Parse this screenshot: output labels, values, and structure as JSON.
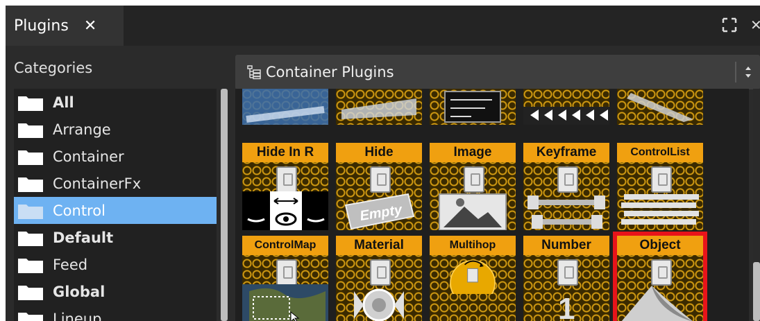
{
  "window": {
    "tab_label": "Plugins",
    "tab_close": "✕",
    "close_glyph": "✕"
  },
  "sidebar": {
    "header": "Categories",
    "items": [
      {
        "label": "All",
        "bold": true
      },
      {
        "label": "Arrange",
        "bold": false
      },
      {
        "label": "Container",
        "bold": false
      },
      {
        "label": "ContainerFx",
        "bold": false
      },
      {
        "label": "Control",
        "bold": false,
        "selected": true
      },
      {
        "label": "Default",
        "bold": true
      },
      {
        "label": "Feed",
        "bold": false
      },
      {
        "label": "Global",
        "bold": true
      },
      {
        "label": "Lineup",
        "bold": false
      }
    ]
  },
  "dropdown": {
    "label": "Container Plugins",
    "icon": "tree-icon"
  },
  "plugins": {
    "row2": [
      {
        "label": "Hide In R"
      },
      {
        "label": "Hide"
      },
      {
        "label": "Image"
      },
      {
        "label": "Keyframe"
      },
      {
        "label": "ControlList"
      }
    ],
    "row3": [
      {
        "label": "ControlMap"
      },
      {
        "label": "Material"
      },
      {
        "label": "Multihop"
      },
      {
        "label": "Number"
      },
      {
        "label": "Object",
        "selected": true
      }
    ],
    "art_texts": {
      "empty": "Empty",
      "number": "1"
    }
  },
  "colors": {
    "accent_selection": "#6eb2f2",
    "plugin_label_bg": "#f0a010",
    "selected_outline": "#e8141a"
  }
}
